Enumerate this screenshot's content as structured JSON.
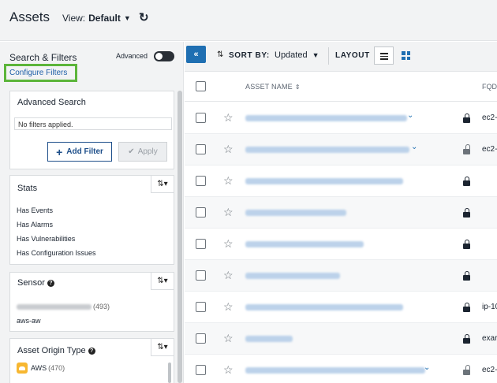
{
  "header": {
    "title": "Assets",
    "view_label": "View:",
    "view_value": "Default"
  },
  "sidebar": {
    "title": "Search & Filters",
    "advanced_label": "Advanced",
    "configure_filters": "Configure Filters",
    "advanced_search": {
      "title": "Advanced Search",
      "input_text": "No filters applied.",
      "add_filter": "Add Filter",
      "apply": "Apply"
    },
    "stats": {
      "title": "Stats",
      "items": [
        "Has Events",
        "Has Alarms",
        "Has Vulnerabilities",
        "Has Configuration Issues"
      ]
    },
    "sensor": {
      "title": "Sensor",
      "items": [
        {
          "label": "",
          "count": "(493)"
        },
        {
          "label": "aws-aw",
          "count": ""
        }
      ]
    },
    "asset_origin_type": {
      "title": "Asset Origin Type",
      "items": [
        {
          "label": "AWS",
          "count": "(470)"
        }
      ]
    }
  },
  "toolbar": {
    "sort_by_label": "SORT BY:",
    "sort_by_value": "Updated",
    "layout_label": "LAYOUT"
  },
  "table": {
    "columns": {
      "asset_name": "ASSET NAME",
      "fqdn": "FQD"
    },
    "rows": [
      {
        "fqdn": "ec2-",
        "locked": true,
        "expandable": true
      },
      {
        "fqdn": "ec2-",
        "locked": false,
        "expandable": true
      },
      {
        "fqdn": "",
        "locked": true,
        "expandable": false
      },
      {
        "fqdn": "",
        "locked": true,
        "expandable": false
      },
      {
        "fqdn": "",
        "locked": true,
        "expandable": false
      },
      {
        "fqdn": "",
        "locked": true,
        "expandable": false
      },
      {
        "fqdn": "ip-10",
        "locked": true,
        "expandable": false
      },
      {
        "fqdn": "exar",
        "locked": true,
        "expandable": false
      },
      {
        "fqdn": "ec2-",
        "locked": false,
        "expandable": true
      }
    ]
  },
  "colors": {
    "accent": "#1f6fb2",
    "highlight_border": "#5cb53a",
    "link": "#1e5fa8"
  }
}
